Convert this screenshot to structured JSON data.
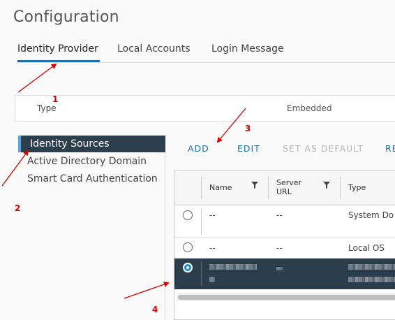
{
  "page": {
    "title": "Configuration"
  },
  "tabs": [
    {
      "label": "Identity Provider",
      "active": true
    },
    {
      "label": "Local Accounts",
      "active": false
    },
    {
      "label": "Login Message",
      "active": false
    }
  ],
  "type_box": {
    "label": "Type",
    "value": "Embedded"
  },
  "side_nav": {
    "items": [
      {
        "label": "Identity Sources",
        "active": true
      },
      {
        "label": "Active Directory Domain",
        "active": false
      },
      {
        "label": "Smart Card Authentication",
        "active": false
      }
    ]
  },
  "actions": {
    "add": "ADD",
    "edit": "EDIT",
    "set_default": "SET AS DEFAULT",
    "more": "RE"
  },
  "grid": {
    "columns": [
      {
        "label": "Name",
        "filter": true
      },
      {
        "label": "Server\nURL",
        "filter": true
      },
      {
        "label": "Type",
        "filter": false
      }
    ],
    "rows": [
      {
        "name": "--",
        "server_url": "--",
        "type": "System Do",
        "selected": false
      },
      {
        "name": "--",
        "server_url": "--",
        "type": "Local OS",
        "selected": false
      },
      {
        "name": "",
        "server_url": "",
        "type": "",
        "selected": true,
        "redacted": true
      }
    ]
  },
  "annotations": {
    "arrow_color": "#d40000",
    "labels": [
      "1",
      "2",
      "3",
      "4"
    ]
  },
  "colors": {
    "accent": "#1f6fae",
    "nav_active_bg": "#2d3e4d",
    "selected_row_bg": "#2b3d4b",
    "radio_checked": "#1991d1"
  }
}
